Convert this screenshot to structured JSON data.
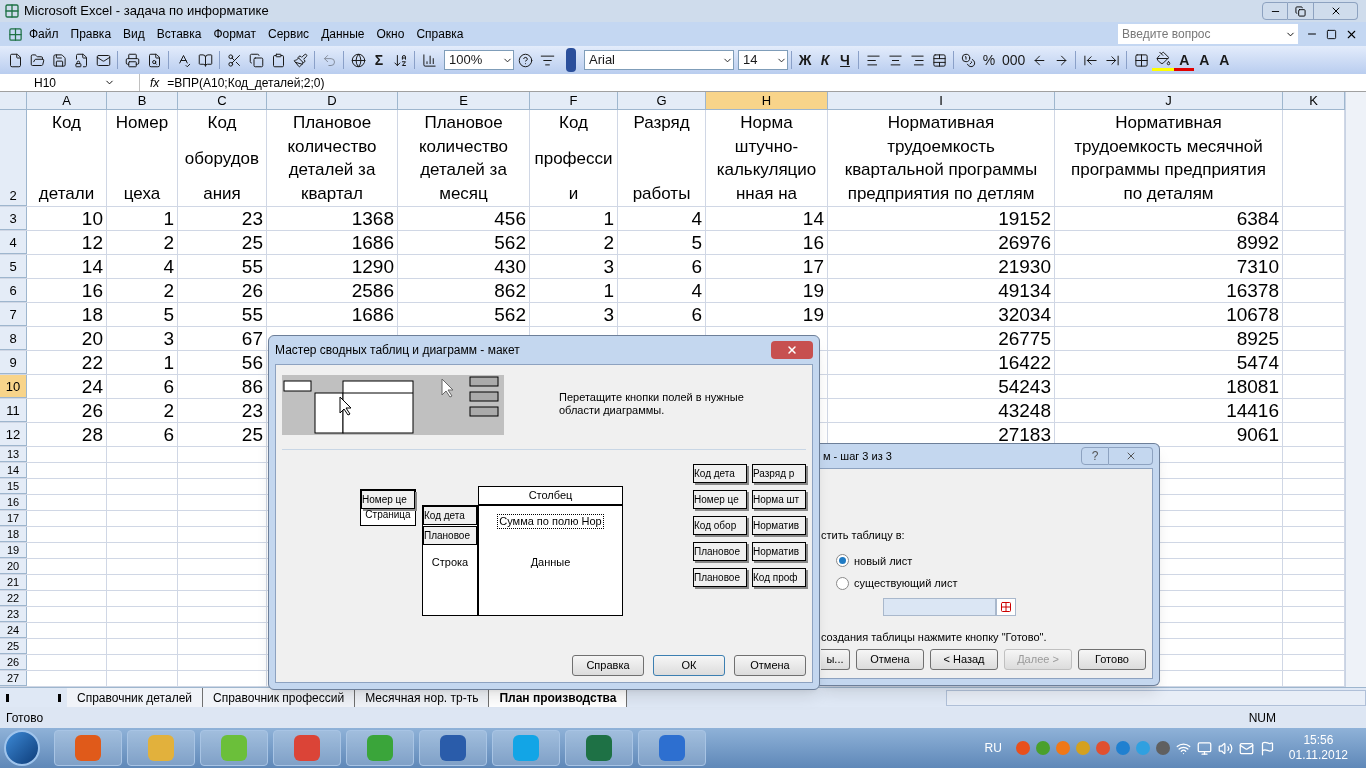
{
  "window": {
    "title": "Microsoft Excel - задача по информатике"
  },
  "menu": [
    "Файл",
    "Правка",
    "Вид",
    "Вставка",
    "Формат",
    "Сервис",
    "Данные",
    "Окно",
    "Справка"
  ],
  "help_search": {
    "placeholder": "Введите вопрос"
  },
  "toolbar": {
    "sum": "Σ",
    "zoom": "100%",
    "font": "Arial",
    "size": "14",
    "bold": "Ж",
    "italic": "К",
    "underline": "Ч",
    "percent": "%",
    "thousands": "000",
    "font_color": "A",
    "grow_font": "A",
    "shrink_font": "A"
  },
  "formula_bar": {
    "cell": "H10",
    "fx": "fx",
    "formula": "=ВПР(A10;Код_деталей;2;0)"
  },
  "columns": [
    {
      "letter": "A",
      "selected": false
    },
    {
      "letter": "B",
      "selected": false
    },
    {
      "letter": "C",
      "selected": false
    },
    {
      "letter": "D",
      "selected": false
    },
    {
      "letter": "E",
      "selected": false
    },
    {
      "letter": "F",
      "selected": false
    },
    {
      "letter": "G",
      "selected": false
    },
    {
      "letter": "H",
      "selected": true
    },
    {
      "letter": "I",
      "selected": false
    },
    {
      "letter": "J",
      "selected": false
    },
    {
      "letter": "K",
      "selected": false
    }
  ],
  "header_row": {
    "number": "2",
    "cells": [
      [
        "Код",
        "детали"
      ],
      [
        "Номер",
        "цеха"
      ],
      [
        "Код",
        "оборудов",
        "ания"
      ],
      [
        "Плановое",
        "количество",
        "деталей за",
        "квартал"
      ],
      [
        "Плановое",
        "количество",
        "деталей за",
        "месяц"
      ],
      [
        "Код",
        "професси",
        "и"
      ],
      [
        "Разряд",
        "работы"
      ],
      [
        "Норма",
        "штучно-",
        "калькуляцио",
        "нная на"
      ],
      [
        "Нормативная",
        "трудоемкость",
        "квартальной программы",
        "предприятия по детлям"
      ],
      [
        "Нормативная",
        "трудоемкость месячной",
        "программы предприятия",
        "по деталям"
      ]
    ]
  },
  "rows": [
    {
      "number": "3",
      "selected": false,
      "cells": [
        "10",
        "1",
        "23",
        "1368",
        "456",
        "1",
        "4",
        "14",
        "19152",
        "6384"
      ]
    },
    {
      "number": "4",
      "selected": false,
      "cells": [
        "12",
        "2",
        "25",
        "1686",
        "562",
        "2",
        "5",
        "16",
        "26976",
        "8992"
      ]
    },
    {
      "number": "5",
      "selected": false,
      "cells": [
        "14",
        "4",
        "55",
        "1290",
        "430",
        "3",
        "6",
        "17",
        "21930",
        "7310"
      ]
    },
    {
      "number": "6",
      "selected": false,
      "cells": [
        "16",
        "2",
        "26",
        "2586",
        "862",
        "1",
        "4",
        "19",
        "49134",
        "16378"
      ]
    },
    {
      "number": "7",
      "selected": false,
      "cells": [
        "18",
        "5",
        "55",
        "1686",
        "562",
        "3",
        "6",
        "19",
        "32034",
        "10678"
      ]
    },
    {
      "number": "8",
      "selected": false,
      "cells": [
        "20",
        "3",
        "67",
        null,
        null,
        null,
        null,
        null,
        "26775",
        "8925"
      ]
    },
    {
      "number": "9",
      "selected": false,
      "cells": [
        "22",
        "1",
        "56",
        null,
        null,
        null,
        null,
        null,
        "16422",
        "5474"
      ]
    },
    {
      "number": "10",
      "selected": true,
      "cells": [
        "24",
        "6",
        "86",
        null,
        null,
        null,
        null,
        null,
        "54243",
        "18081"
      ]
    },
    {
      "number": "11",
      "selected": false,
      "cells": [
        "26",
        "2",
        "23",
        null,
        null,
        null,
        null,
        null,
        "43248",
        "14416"
      ]
    },
    {
      "number": "12",
      "selected": false,
      "cells": [
        "28",
        "6",
        "25",
        null,
        null,
        null,
        null,
        null,
        "27183",
        "9061"
      ]
    }
  ],
  "empty_rows": [
    "13",
    "14",
    "15",
    "16",
    "17",
    "18",
    "19",
    "20",
    "21",
    "22",
    "23",
    "24",
    "25",
    "26",
    "27"
  ],
  "sheet_tabs": [
    {
      "label": "Справочник деталей",
      "selected": false
    },
    {
      "label": "Справочник профессий",
      "selected": false
    },
    {
      "label": "Месячная нор. тр-ть",
      "selected": false
    },
    {
      "label": "План производства",
      "selected": true
    }
  ],
  "status_bar": {
    "text": "Готово",
    "num": "NUM"
  },
  "layout_dialog": {
    "title": "Мастер сводных таблиц и диаграмм - макет",
    "instruction": "Перетащите кнопки полей в нужные области диаграммы.",
    "page_area": {
      "label": "Страница",
      "fields": [
        "Номер це"
      ]
    },
    "column_area": {
      "label": "Столбец"
    },
    "row_area": {
      "label": "Строка",
      "fields": [
        "Код дета",
        "Плановое"
      ]
    },
    "data_area": {
      "label": "Данные",
      "fields": [
        "Сумма по полю Нор"
      ]
    },
    "field_buttons": [
      "Код дета",
      "Разряд р",
      "Номер це",
      "Норма шт",
      "Код обор",
      "Норматив",
      "Плановое",
      "Норматив",
      "Плановое",
      "Код проф"
    ],
    "buttons": [
      {
        "label": "Справка",
        "default": false
      },
      {
        "label": "ОК",
        "default": true
      },
      {
        "label": "Отмена",
        "default": false
      }
    ]
  },
  "wizard_dialog": {
    "title": "м - шаг 3 из 3",
    "help": "?",
    "prompt": "стить таблицу в:",
    "options": [
      {
        "label": "новый лист",
        "selected": true
      },
      {
        "label": "существующий лист",
        "selected": false
      }
    ],
    "hint": "создания таблицы нажмите кнопку \"Готово\".",
    "buttons": [
      {
        "label": "ы...",
        "disabled": false
      },
      {
        "label": "Отмена",
        "disabled": false
      },
      {
        "label": "< Назад",
        "disabled": false
      },
      {
        "label": "Далее >",
        "disabled": true
      },
      {
        "label": "Готово",
        "disabled": false
      }
    ]
  },
  "taskbar": {
    "language": "RU",
    "time": "15:56",
    "date": "01.11.2012"
  }
}
